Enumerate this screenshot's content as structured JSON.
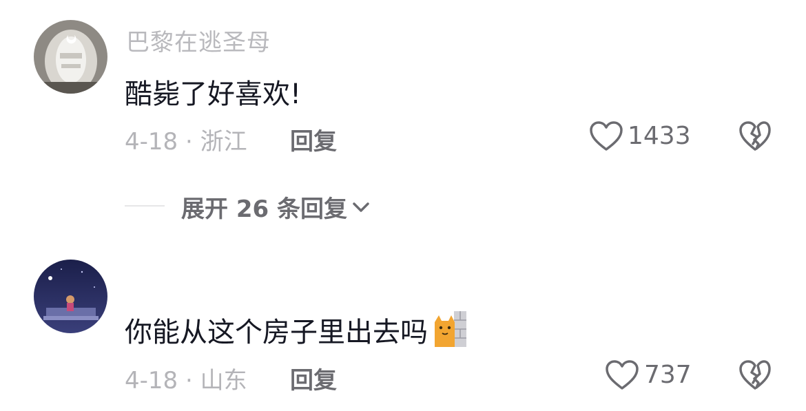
{
  "comments": [
    {
      "username": "巴黎在逃圣母",
      "text": "酷毙了好喜欢!",
      "meta": "4-18 · 浙江",
      "reply_label": "回复",
      "likes": "1433",
      "expand_label": "展开 26 条回复"
    },
    {
      "username": "",
      "text": "你能从这个房子里出去吗",
      "emoji": "cat-peeking-emoji",
      "meta": "4-18 · 山东",
      "reply_label": "回复",
      "likes": "737"
    }
  ],
  "icons": {
    "like": "heart-outline-icon",
    "dislike": "broken-heart-icon",
    "expand": "chevron-down-icon"
  },
  "colors": {
    "text_primary": "#161823",
    "text_secondary": "#b4b4b8",
    "action": "#6b6b70"
  }
}
